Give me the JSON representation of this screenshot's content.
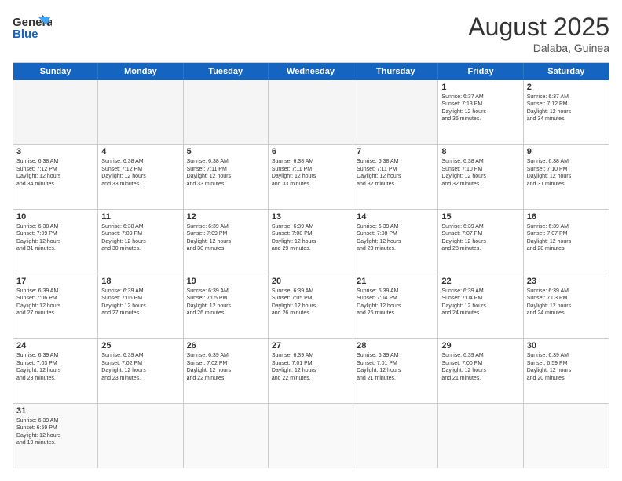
{
  "header": {
    "logo_general": "General",
    "logo_blue": "Blue",
    "month_title": "August 2025",
    "location": "Dalaba, Guinea"
  },
  "days_of_week": [
    "Sunday",
    "Monday",
    "Tuesday",
    "Wednesday",
    "Thursday",
    "Friday",
    "Saturday"
  ],
  "weeks": [
    [
      {
        "day": "",
        "info": "",
        "empty": true
      },
      {
        "day": "",
        "info": "",
        "empty": true
      },
      {
        "day": "",
        "info": "",
        "empty": true
      },
      {
        "day": "",
        "info": "",
        "empty": true
      },
      {
        "day": "",
        "info": "",
        "empty": true
      },
      {
        "day": "1",
        "info": "Sunrise: 6:37 AM\nSunset: 7:13 PM\nDaylight: 12 hours\nand 35 minutes."
      },
      {
        "day": "2",
        "info": "Sunrise: 6:37 AM\nSunset: 7:12 PM\nDaylight: 12 hours\nand 34 minutes."
      }
    ],
    [
      {
        "day": "3",
        "info": "Sunrise: 6:38 AM\nSunset: 7:12 PM\nDaylight: 12 hours\nand 34 minutes."
      },
      {
        "day": "4",
        "info": "Sunrise: 6:38 AM\nSunset: 7:12 PM\nDaylight: 12 hours\nand 33 minutes."
      },
      {
        "day": "5",
        "info": "Sunrise: 6:38 AM\nSunset: 7:11 PM\nDaylight: 12 hours\nand 33 minutes."
      },
      {
        "day": "6",
        "info": "Sunrise: 6:38 AM\nSunset: 7:11 PM\nDaylight: 12 hours\nand 33 minutes."
      },
      {
        "day": "7",
        "info": "Sunrise: 6:38 AM\nSunset: 7:11 PM\nDaylight: 12 hours\nand 32 minutes."
      },
      {
        "day": "8",
        "info": "Sunrise: 6:38 AM\nSunset: 7:10 PM\nDaylight: 12 hours\nand 32 minutes."
      },
      {
        "day": "9",
        "info": "Sunrise: 6:38 AM\nSunset: 7:10 PM\nDaylight: 12 hours\nand 31 minutes."
      }
    ],
    [
      {
        "day": "10",
        "info": "Sunrise: 6:38 AM\nSunset: 7:09 PM\nDaylight: 12 hours\nand 31 minutes."
      },
      {
        "day": "11",
        "info": "Sunrise: 6:38 AM\nSunset: 7:09 PM\nDaylight: 12 hours\nand 30 minutes."
      },
      {
        "day": "12",
        "info": "Sunrise: 6:39 AM\nSunset: 7:09 PM\nDaylight: 12 hours\nand 30 minutes."
      },
      {
        "day": "13",
        "info": "Sunrise: 6:39 AM\nSunset: 7:08 PM\nDaylight: 12 hours\nand 29 minutes."
      },
      {
        "day": "14",
        "info": "Sunrise: 6:39 AM\nSunset: 7:08 PM\nDaylight: 12 hours\nand 29 minutes."
      },
      {
        "day": "15",
        "info": "Sunrise: 6:39 AM\nSunset: 7:07 PM\nDaylight: 12 hours\nand 28 minutes."
      },
      {
        "day": "16",
        "info": "Sunrise: 6:39 AM\nSunset: 7:07 PM\nDaylight: 12 hours\nand 28 minutes."
      }
    ],
    [
      {
        "day": "17",
        "info": "Sunrise: 6:39 AM\nSunset: 7:06 PM\nDaylight: 12 hours\nand 27 minutes."
      },
      {
        "day": "18",
        "info": "Sunrise: 6:39 AM\nSunset: 7:06 PM\nDaylight: 12 hours\nand 27 minutes."
      },
      {
        "day": "19",
        "info": "Sunrise: 6:39 AM\nSunset: 7:05 PM\nDaylight: 12 hours\nand 26 minutes."
      },
      {
        "day": "20",
        "info": "Sunrise: 6:39 AM\nSunset: 7:05 PM\nDaylight: 12 hours\nand 26 minutes."
      },
      {
        "day": "21",
        "info": "Sunrise: 6:39 AM\nSunset: 7:04 PM\nDaylight: 12 hours\nand 25 minutes."
      },
      {
        "day": "22",
        "info": "Sunrise: 6:39 AM\nSunset: 7:04 PM\nDaylight: 12 hours\nand 24 minutes."
      },
      {
        "day": "23",
        "info": "Sunrise: 6:39 AM\nSunset: 7:03 PM\nDaylight: 12 hours\nand 24 minutes."
      }
    ],
    [
      {
        "day": "24",
        "info": "Sunrise: 6:39 AM\nSunset: 7:03 PM\nDaylight: 12 hours\nand 23 minutes."
      },
      {
        "day": "25",
        "info": "Sunrise: 6:39 AM\nSunset: 7:02 PM\nDaylight: 12 hours\nand 23 minutes."
      },
      {
        "day": "26",
        "info": "Sunrise: 6:39 AM\nSunset: 7:02 PM\nDaylight: 12 hours\nand 22 minutes."
      },
      {
        "day": "27",
        "info": "Sunrise: 6:39 AM\nSunset: 7:01 PM\nDaylight: 12 hours\nand 22 minutes."
      },
      {
        "day": "28",
        "info": "Sunrise: 6:39 AM\nSunset: 7:01 PM\nDaylight: 12 hours\nand 21 minutes."
      },
      {
        "day": "29",
        "info": "Sunrise: 6:39 AM\nSunset: 7:00 PM\nDaylight: 12 hours\nand 21 minutes."
      },
      {
        "day": "30",
        "info": "Sunrise: 6:39 AM\nSunset: 6:59 PM\nDaylight: 12 hours\nand 20 minutes."
      }
    ],
    [
      {
        "day": "31",
        "info": "Sunrise: 6:39 AM\nSunset: 6:59 PM\nDaylight: 12 hours\nand 19 minutes."
      },
      {
        "day": "",
        "info": "",
        "empty": true
      },
      {
        "day": "",
        "info": "",
        "empty": true
      },
      {
        "day": "",
        "info": "",
        "empty": true
      },
      {
        "day": "",
        "info": "",
        "empty": true
      },
      {
        "day": "",
        "info": "",
        "empty": true
      },
      {
        "day": "",
        "info": "",
        "empty": true
      }
    ]
  ]
}
